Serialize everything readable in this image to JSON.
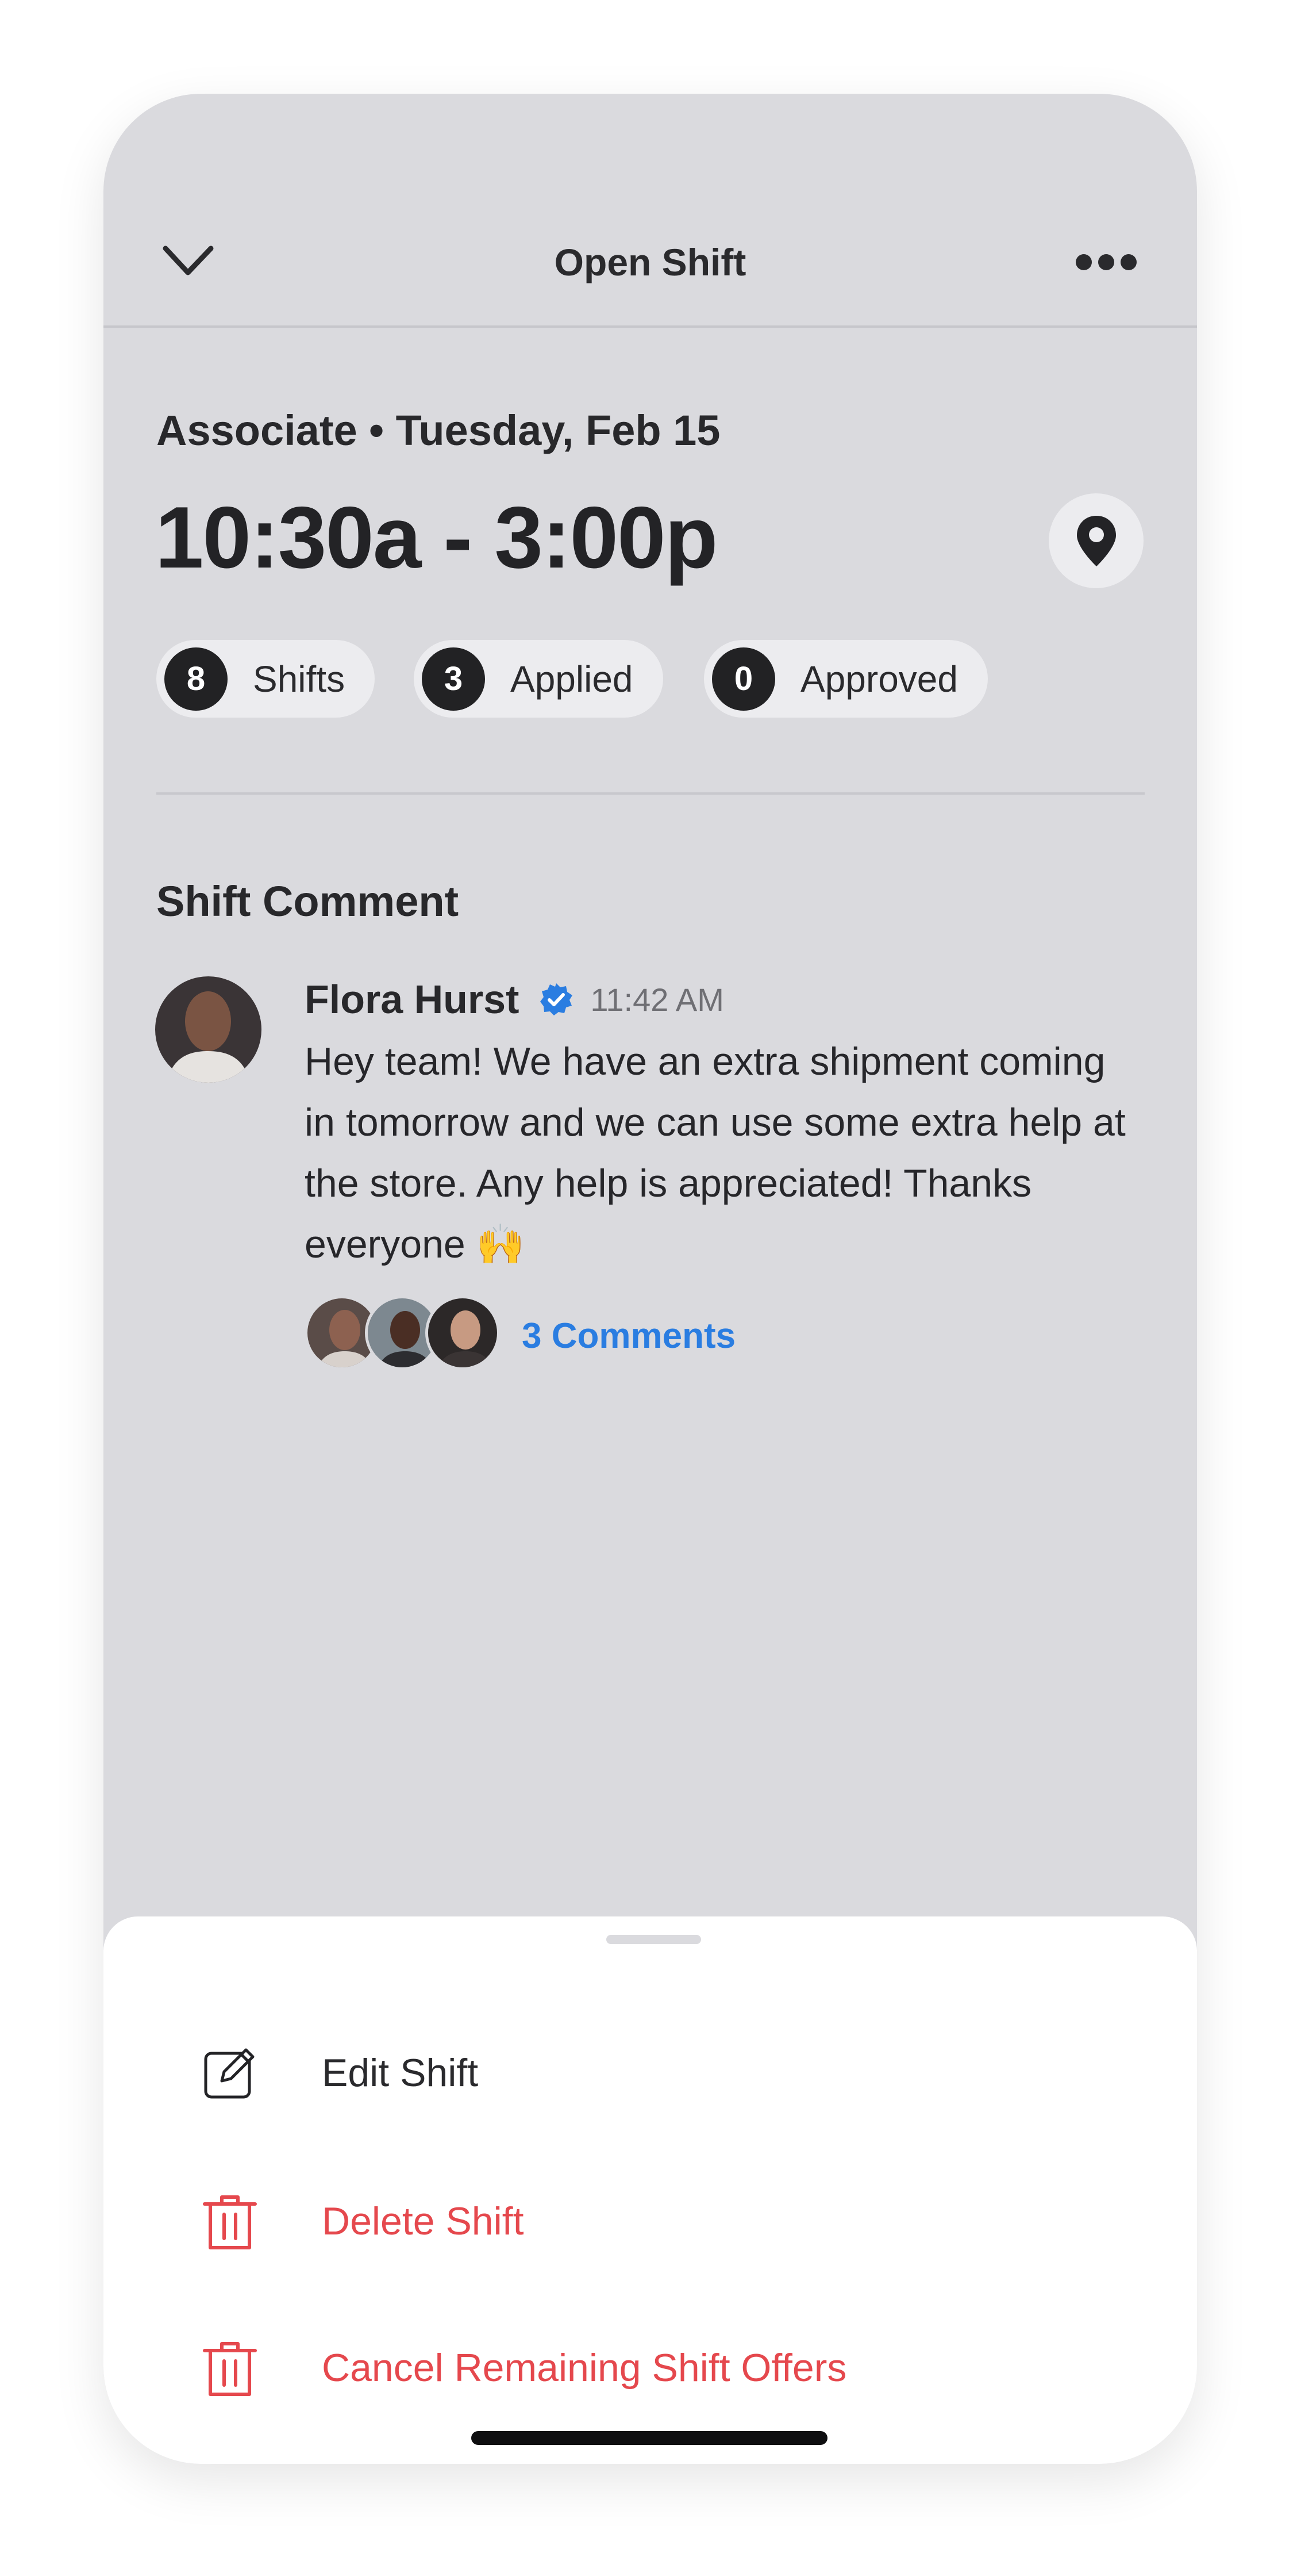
{
  "header": {
    "title": "Open Shift",
    "back_icon": "chevron-down-icon",
    "more_icon": "more-dots-icon"
  },
  "shift": {
    "meta": "Associate • Tuesday, Feb 15",
    "time": "10:30a - 3:00p",
    "location_icon": "location-pin-icon",
    "stats": [
      {
        "count": "8",
        "label": "Shifts"
      },
      {
        "count": "3",
        "label": "Applied"
      },
      {
        "count": "0",
        "label": "Approved"
      }
    ]
  },
  "comment_section": {
    "title": "Shift Comment",
    "author": "Flora Hurst",
    "verified": true,
    "time": "11:42 AM",
    "body": "Hey team! We have an extra shipment coming in tomorrow and we can use some extra help at the store. Any help is appreciated! Thanks everyone 🙌",
    "comments_link": "3 Comments"
  },
  "sheet": {
    "actions": [
      {
        "label": "Edit Shift",
        "icon": "edit-icon",
        "color": "#2a2a2d"
      },
      {
        "label": "Delete Shift",
        "icon": "trash-icon",
        "color": "#e5484d"
      },
      {
        "label": "Cancel Remaining Shift Offers",
        "icon": "trash-icon",
        "color": "#e5484d"
      }
    ]
  },
  "colors": {
    "accent": "#2a7de1",
    "danger": "#e5484d",
    "background": "#dadade"
  }
}
